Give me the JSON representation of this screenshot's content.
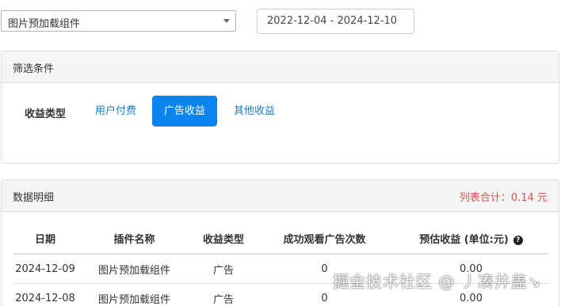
{
  "plugin_select": {
    "value": "图片预加载组件"
  },
  "date_range": {
    "value": "2022-12-04 - 2024-12-10"
  },
  "filter_panel": {
    "title": "筛选条件",
    "label": "收益类型",
    "tabs": [
      {
        "label": "用户付费",
        "active": false
      },
      {
        "label": "广告收益",
        "active": true
      },
      {
        "label": "其他收益",
        "active": false
      }
    ]
  },
  "data_panel": {
    "title": "数据明细",
    "total": "列表合计：0.14 元",
    "columns": [
      "日期",
      "插件名称",
      "收益类型",
      "成功观看广告次数",
      "预估收益 (单位:元)"
    ],
    "help_icon": "question-circle-icon",
    "rows": [
      [
        "2024-12-09",
        "图片预加载组件",
        "广告",
        "0",
        "0.00"
      ],
      [
        "2024-12-08",
        "图片预加载组件",
        "广告",
        "0",
        "0.00"
      ]
    ]
  },
  "watermark": "掘金技术社区 @ 丿凑井盖↘",
  "colors": {
    "active_tab": "#0b84ee",
    "link": "#1a7ec8",
    "total": "#d9534f"
  }
}
